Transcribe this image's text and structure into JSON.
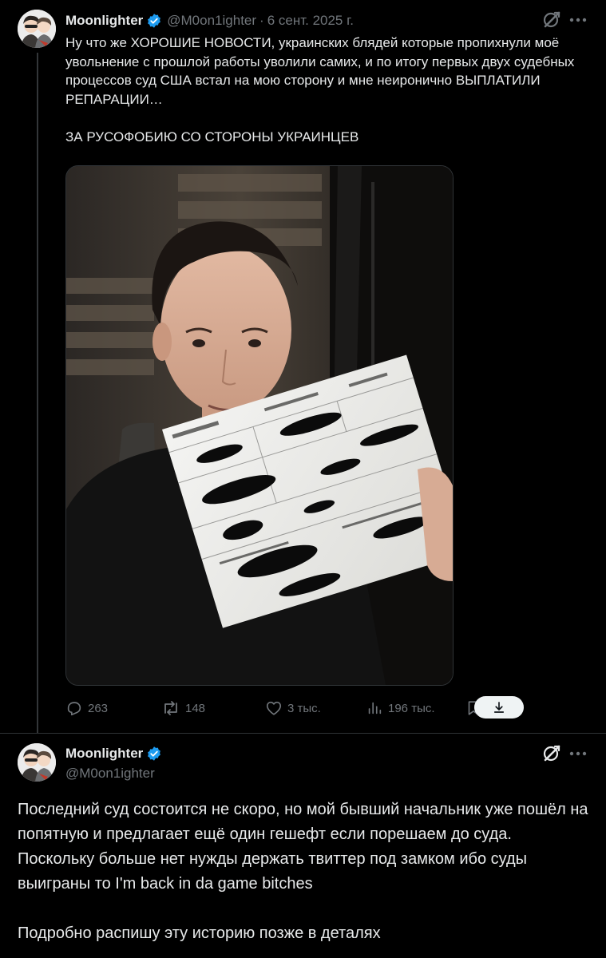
{
  "tweet_main": {
    "author": {
      "name": "Moonlighter",
      "handle": "@M0on1ighter"
    },
    "separator": "·",
    "date": "6 сент. 2025 г.",
    "paragraphs": [
      "Ну что же ХОРОШИЕ НОВОСТИ, украинских блядей которые пропихнули моё увольнение с прошлой работы уволили самих, и по итогу первых двух судебных процессов суд США встал на мою сторону и мне неиронично ВЫПЛАТИЛИ РЕПАРАЦИИ…",
      "ЗА РУСОФОБИЮ СО СТОРОНЫ УКРАИНЦЕВ"
    ],
    "actions": {
      "replies": "263",
      "reposts": "148",
      "likes": "3 тыс.",
      "views": "196 тыс."
    }
  },
  "tweet_reply": {
    "author": {
      "name": "Moonlighter",
      "handle": "@M0on1ighter"
    },
    "paragraphs": [
      "Последний суд состоится не скоро, но мой бывший начальник уже пошёл на попятную и предлагает ещё один гешефт если порешаем до суда. Поскольку больше нет нужды держать твиттер под замком ибо суды выиграны то I'm back in da game bitches",
      "Подробно распишу эту историю позже в деталях"
    ]
  },
  "colors": {
    "background": "#000000",
    "text": "#e7e9ea",
    "muted": "#71767b",
    "border": "#2f3336",
    "verified": "#1d9bf0"
  },
  "icons": [
    "verified-badge-icon",
    "grok-icon",
    "more-icon",
    "reply-icon",
    "repost-icon",
    "like-icon",
    "views-icon",
    "bookmark-icon",
    "share-icon",
    "download-icon"
  ]
}
